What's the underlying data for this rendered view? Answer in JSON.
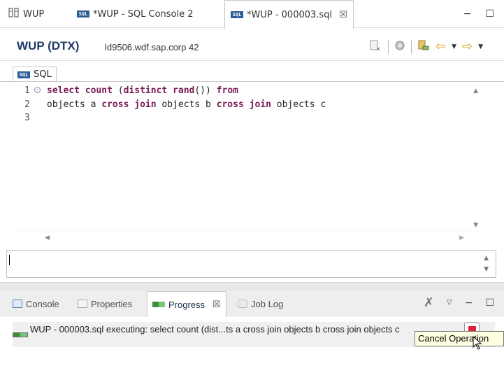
{
  "tabs": [
    {
      "label": "WUP",
      "icon": "wup-db-icon",
      "active": false
    },
    {
      "label": "*WUP - SQL Console 2",
      "icon": "sql-icon",
      "active": false
    },
    {
      "label": "*WUP - 000003.sql",
      "icon": "sql-icon",
      "active": true,
      "close": "☒"
    }
  ],
  "window_buttons": {
    "minimize": "−",
    "maximize": "☐"
  },
  "connection": {
    "title": "WUP (DTX)",
    "host": "ld9506.wdf.sap.corp 42"
  },
  "editor": {
    "subtab_label": "SQL",
    "line_numbers": [
      "1",
      "2",
      "3"
    ],
    "lines": [
      [
        {
          "t": "select",
          "kw": true
        },
        {
          "t": " ",
          "kw": false
        },
        {
          "t": "count",
          "kw": true
        },
        {
          "t": " (",
          "kw": false
        },
        {
          "t": "distinct",
          "kw": true
        },
        {
          "t": " ",
          "kw": false
        },
        {
          "t": "rand",
          "kw": true
        },
        {
          "t": "()) ",
          "kw": false
        },
        {
          "t": "from",
          "kw": true
        }
      ],
      [
        {
          "t": "objects a ",
          "kw": false
        },
        {
          "t": "cross",
          "kw": true
        },
        {
          "t": " ",
          "kw": false
        },
        {
          "t": "join",
          "kw": true
        },
        {
          "t": " objects b ",
          "kw": false
        },
        {
          "t": "cross",
          "kw": true
        },
        {
          "t": " ",
          "kw": false
        },
        {
          "t": "join",
          "kw": true
        },
        {
          "t": " objects c",
          "kw": false
        }
      ],
      []
    ]
  },
  "view_tabs": [
    {
      "label": "Console",
      "icon": "console-icon",
      "active": false
    },
    {
      "label": "Properties",
      "icon": "properties-icon",
      "active": false
    },
    {
      "label": "Progress",
      "icon": "progress-icon",
      "active": true,
      "close": "☒"
    },
    {
      "label": "Job Log",
      "icon": "job-log-icon",
      "active": false
    }
  ],
  "progress": {
    "text": "WUP - 000003.sql executing: select count (dist...ts a cross join objects b cross join objects c",
    "stop_button_color": "#e0203a"
  },
  "tooltip": "Cancel Operation",
  "colors": {
    "keyword": "#7a1c56",
    "connection_title": "#1f3b66",
    "sql_icon": "#2c5d9a"
  }
}
